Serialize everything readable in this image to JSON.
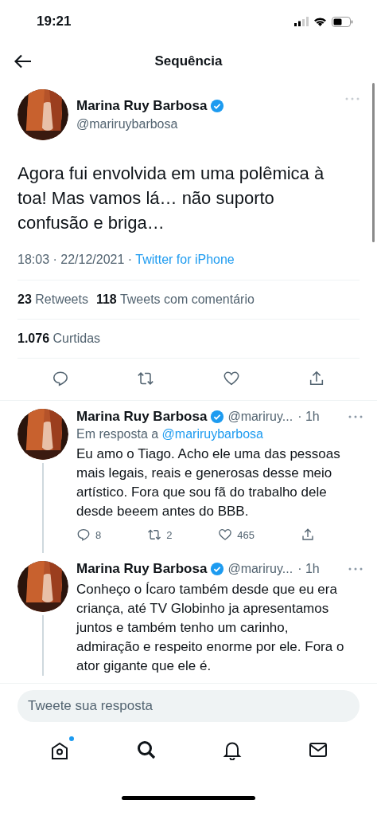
{
  "status_bar": {
    "time": "19:21"
  },
  "header": {
    "title": "Sequência"
  },
  "tweet": {
    "name": "Marina Ruy Barbosa",
    "verified": true,
    "handle": "@mariruybarbosa",
    "text": "Agora fui envolvida em uma polêmica à toa! Mas vamos lá… não suporto confusão e briga…",
    "time": "18:03 · 22/12/2021 · ",
    "source": "Twitter for iPhone",
    "stats": [
      {
        "count": "23",
        "label": "Retweets"
      },
      {
        "count": "118",
        "label": "Tweets com comentário"
      }
    ],
    "likes": {
      "count": "1.076",
      "label": "Curtidas"
    }
  },
  "replies": [
    {
      "name": "Marina Ruy Barbosa",
      "verified": true,
      "handle": "@mariruy...",
      "age": "· 1h",
      "reply_prefix": "Em resposta a ",
      "reply_to": "@mariruybarbosa",
      "text": "Eu amo o Tiago. Acho ele uma das pessoas mais legais, reais e generosas desse meio artístico. Fora que sou fã do trabalho dele desde beeem antes do BBB.",
      "counts": {
        "replies": "8",
        "retweets": "2",
        "likes": "465"
      }
    },
    {
      "name": "Marina Ruy Barbosa",
      "verified": true,
      "handle": "@mariruy...",
      "age": "· 1h",
      "text": "Conheço o Ícaro também desde que eu era criança, até TV Globinho ja apresentamos juntos e também tenho um carinho, admiração e respeito enorme por ele. Fora o ator gigante que ele é."
    }
  ],
  "reply_field": {
    "placeholder": "Tweete sua resposta"
  },
  "nav": [
    {
      "kind": "home",
      "selected": false,
      "badge": true
    },
    {
      "kind": "search",
      "selected": true,
      "badge": false
    },
    {
      "kind": "notifications",
      "selected": false,
      "badge": false
    },
    {
      "kind": "messages",
      "selected": false,
      "badge": false
    }
  ]
}
